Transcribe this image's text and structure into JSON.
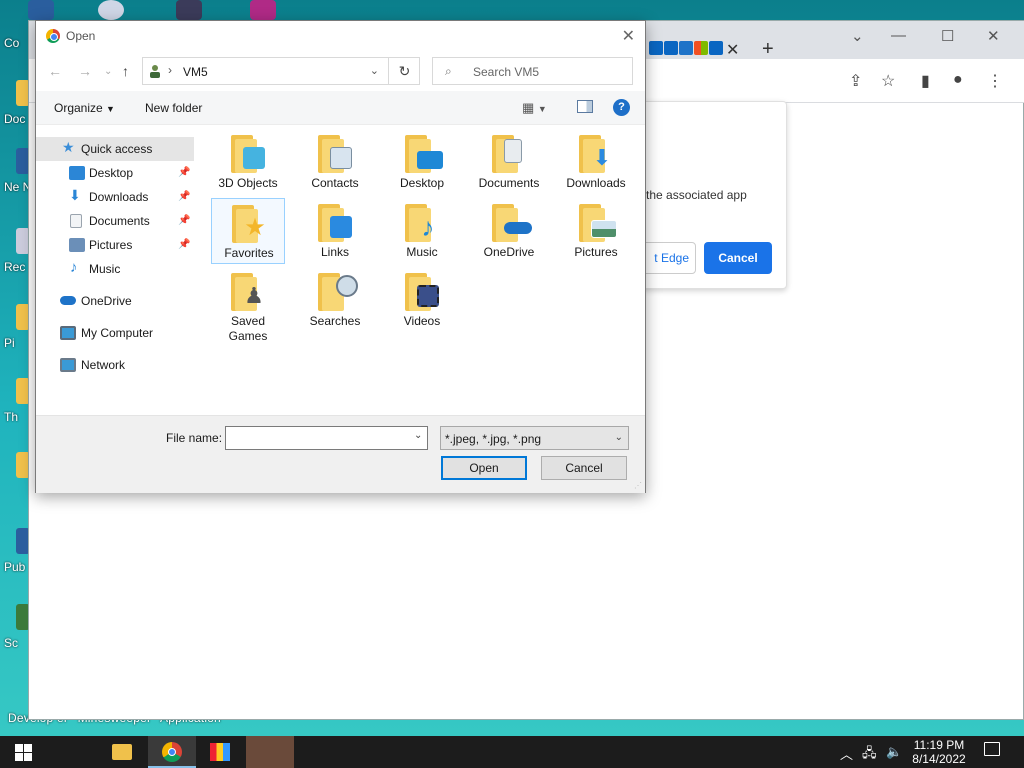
{
  "desktop": {
    "left_icons": [
      "Co",
      "Doc",
      "Ne Neigh",
      "Rec",
      "Pi",
      "Th",
      "Pub",
      "Sc"
    ],
    "bottom_labels": [
      "Develop er",
      "Minesweeper",
      "Application"
    ]
  },
  "browser": {
    "info_text": "the associated app",
    "edge_button": "t Edge",
    "cancel_button": "Cancel"
  },
  "dialog": {
    "title": "Open",
    "path": "VM5",
    "search_placeholder": "Search VM5",
    "organize": "Organize",
    "new_folder": "New folder",
    "nav": [
      {
        "label": "Quick access",
        "icon": "star-icon",
        "color": "#3b8ed8"
      },
      {
        "label": "Desktop",
        "icon": "desktop-icon",
        "color": "#2b86d6"
      },
      {
        "label": "Downloads",
        "icon": "download-arrow-icon",
        "color": "#2b86d6"
      },
      {
        "label": "Documents",
        "icon": "document-icon",
        "color": "#9aa4ae"
      },
      {
        "label": "Pictures",
        "icon": "pictures-icon",
        "color": "#6b8fb8"
      },
      {
        "label": "Music",
        "icon": "music-note-icon",
        "color": "#2b86d6"
      },
      {
        "label": "OneDrive",
        "icon": "cloud-icon",
        "color": "#1e73c8"
      },
      {
        "label": "My Computer",
        "icon": "computer-icon",
        "color": "#3a9ad6"
      },
      {
        "label": "Network",
        "icon": "network-icon",
        "color": "#3a9ad6"
      }
    ],
    "items": [
      {
        "label": "3D Objects",
        "overlay": "#45b3e0"
      },
      {
        "label": "Contacts",
        "overlay": "#d8e4ef"
      },
      {
        "label": "Desktop",
        "overlay": "#1e88d6"
      },
      {
        "label": "Documents",
        "overlay": "#e8ecef"
      },
      {
        "label": "Downloads",
        "overlay": "#2a8ae0"
      },
      {
        "label": "Favorites",
        "overlay": "#f3b62a"
      },
      {
        "label": "Links",
        "overlay": "#2a8ae0"
      },
      {
        "label": "Music",
        "overlay": "#1e88d6"
      },
      {
        "label": "OneDrive",
        "overlay": "#1e73c8"
      },
      {
        "label": "Pictures",
        "overlay": "#8fb2c8"
      },
      {
        "label": "Saved Games",
        "overlay": "#6a6a6a"
      },
      {
        "label": "Searches",
        "overlay": "#cfdde8"
      },
      {
        "label": "Videos",
        "overlay": "#3a4f8a"
      }
    ],
    "file_name_label": "File name:",
    "file_name_value": "",
    "file_type": "*.jpeg, *.jpg, *.png",
    "open_button": "Open",
    "cancel_button": "Cancel"
  },
  "taskbar": {
    "time": "11:19 PM",
    "date": "8/14/2022"
  }
}
